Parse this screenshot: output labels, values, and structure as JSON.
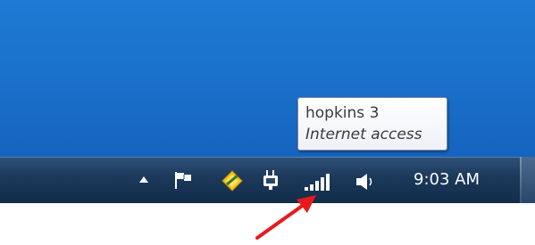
{
  "tooltip": {
    "network_name": "hopkins 3",
    "status": "Internet access"
  },
  "tray": {
    "clock": "9:03 AM",
    "icons": [
      "show-hidden-icons-arrow",
      "action-center-flag-icon",
      "update-icon",
      "power-plug-icon",
      "network-signal-icon",
      "volume-icon"
    ]
  },
  "colors": {
    "desktop": "#1a72cc",
    "taskbar": "#1c3a5c",
    "annotation_arrow": "#e8191d"
  }
}
